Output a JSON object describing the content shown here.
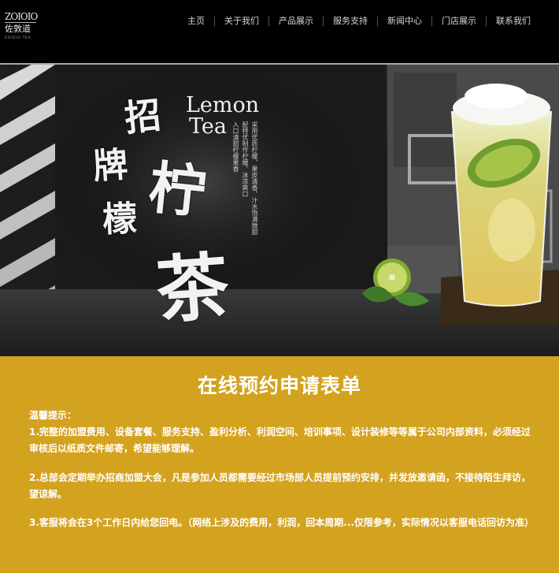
{
  "logo": {
    "mark": "ZOIOIO",
    "name": "佐敦道",
    "sub": "ZOIOIO TEA"
  },
  "nav": {
    "items": [
      {
        "label": "主页"
      },
      {
        "label": "关于我们"
      },
      {
        "label": "产品展示"
      },
      {
        "label": "服务支持"
      },
      {
        "label": "新闻中心"
      },
      {
        "label": "门店展示"
      },
      {
        "label": "联系我们"
      }
    ]
  },
  "banner": {
    "calligraphy": [
      "招",
      "牌",
      "柠",
      "檬",
      "茶"
    ],
    "english_line1": "Lemon",
    "english_line2": "Tea",
    "vertical_texts": [
      "采用优质柠檬、果皮清香、汁水饱满微甜",
      "配特优制作柠檬，冰凉爽口",
      "入口清甜柠檬果香"
    ]
  },
  "form": {
    "title": "在线预约申请表单",
    "tips_label": "温馨提示：",
    "tips": [
      "1.完整的加盟费用、设备套餐、服务支持、盈利分析、利润空间、培训事项、设计装修等等属于公司内部资料，必须经过审核后以纸质文件邮寄，希望能够理解。",
      "2.总部会定期举办招商加盟大会，凡是参加人员都需要经过市场部人员提前预约安排，并发放邀请函，不接待陌生拜访，望谅解。",
      "3.客服将会在3个工作日内给您回电。（网络上涉及的费用，利润，回本周期...仅限参考，实际情况以客服电话回访为准）"
    ]
  },
  "colors": {
    "header_bg": "#000000",
    "form_bg": "#d3a21e",
    "text_light": "#ffffff"
  }
}
